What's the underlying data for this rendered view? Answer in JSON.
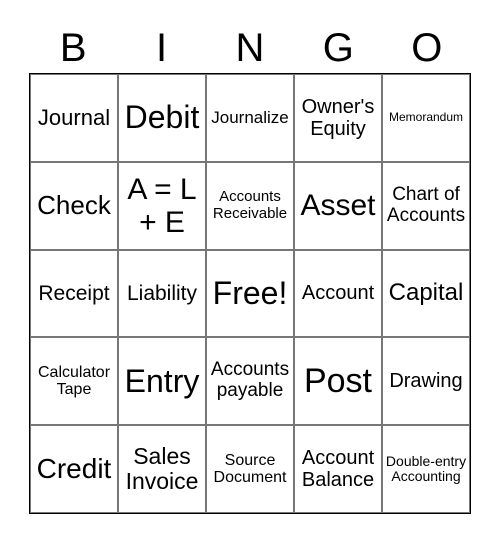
{
  "header": [
    "B",
    "I",
    "N",
    "G",
    "O"
  ],
  "cells": [
    "Journal",
    "Debit",
    "Journalize",
    "Owner's Equity",
    "Memorandum",
    "Check",
    "A = L + E",
    "Accounts Receivable",
    "Asset",
    "Chart of Accounts",
    "Receipt",
    "Liability",
    "Free!",
    "Account",
    "Capital",
    "Calculator Tape",
    "Entry",
    "Accounts payable",
    "Post",
    "Drawing",
    "Credit",
    "Sales Invoice",
    "Source Document",
    "Account Balance",
    "Double-entry Accounting"
  ]
}
